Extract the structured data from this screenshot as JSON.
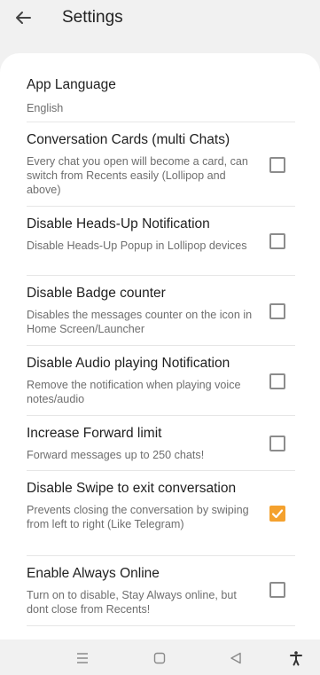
{
  "header": {
    "title": "Settings",
    "back_icon": "arrow-left-icon"
  },
  "accent_color": "#f4a12e",
  "settings": [
    {
      "title": "App Language",
      "subtitle": "English"
    },
    {
      "title": "Conversation Cards (multi Chats)",
      "subtitle": "Every chat you open will become a card, can switch from Recents easily (Lollipop and above)",
      "checked": false
    },
    {
      "title": "Disable Heads-Up Notification",
      "subtitle": "Disable Heads-Up Popup in Lollipop devices",
      "checked": false
    },
    {
      "title": "Disable Badge counter",
      "subtitle": "Disables the messages counter on the icon in Home Screen/Launcher",
      "checked": false
    },
    {
      "title": "Disable Audio playing Notification",
      "subtitle": "Remove the notification when playing voice notes/audio",
      "checked": false
    },
    {
      "title": "Increase Forward limit",
      "subtitle": "Forward messages up to 250 chats!",
      "checked": false
    },
    {
      "title": "Disable Swipe to exit conversation",
      "subtitle": "Prevents closing the conversation by swiping from left to right (Like Telegram)",
      "checked": true
    },
    {
      "title": "Enable Always Online",
      "subtitle": "Turn on to disable, Stay Always online, but dont close from Recents!",
      "checked": false
    }
  ],
  "navbar": {
    "icons": [
      "menu-icon",
      "home-icon",
      "back-triangle-icon",
      "accessibility-icon"
    ]
  }
}
